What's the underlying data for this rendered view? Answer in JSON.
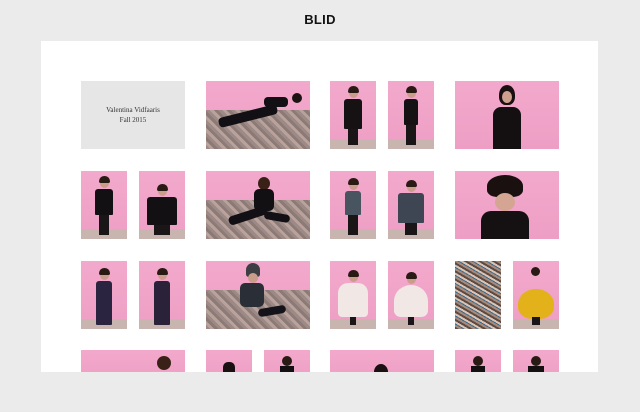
{
  "site": {
    "title": "BLID"
  },
  "collection": {
    "designer": "Valentina Vidfaaris",
    "season": "Fall 2015"
  },
  "colors": {
    "background": "#ebebeb",
    "panel": "#ffffff",
    "backdrop_pink": "#efa3c8",
    "text_tile": "#e6e6e6"
  },
  "gallery": {
    "tiles": [
      {
        "name": "look-photo-1",
        "desc": "model lying on rug"
      },
      {
        "name": "look-photo-2",
        "desc": "model in black coat"
      },
      {
        "name": "look-photo-3",
        "desc": "model back view"
      },
      {
        "name": "look-photo-4",
        "desc": "model with black hair"
      },
      {
        "name": "look-photo-5",
        "desc": "model black outfit"
      },
      {
        "name": "look-photo-6",
        "desc": "model black jacket"
      },
      {
        "name": "look-photo-7",
        "desc": "model sitting on rug"
      },
      {
        "name": "look-photo-8",
        "desc": "model grey coat"
      },
      {
        "name": "look-photo-9",
        "desc": "model grey coat back"
      },
      {
        "name": "look-photo-10",
        "desc": "model fur hat"
      },
      {
        "name": "look-photo-11",
        "desc": "model navy gown"
      },
      {
        "name": "look-photo-12",
        "desc": "model navy gown back"
      },
      {
        "name": "look-photo-13",
        "desc": "model with knit hat seated"
      },
      {
        "name": "look-photo-14",
        "desc": "model white dress"
      },
      {
        "name": "look-photo-15",
        "desc": "model white dress twirl"
      },
      {
        "name": "look-photo-16",
        "desc": "carpet texture"
      },
      {
        "name": "look-photo-17",
        "desc": "model yellow dress"
      }
    ]
  }
}
